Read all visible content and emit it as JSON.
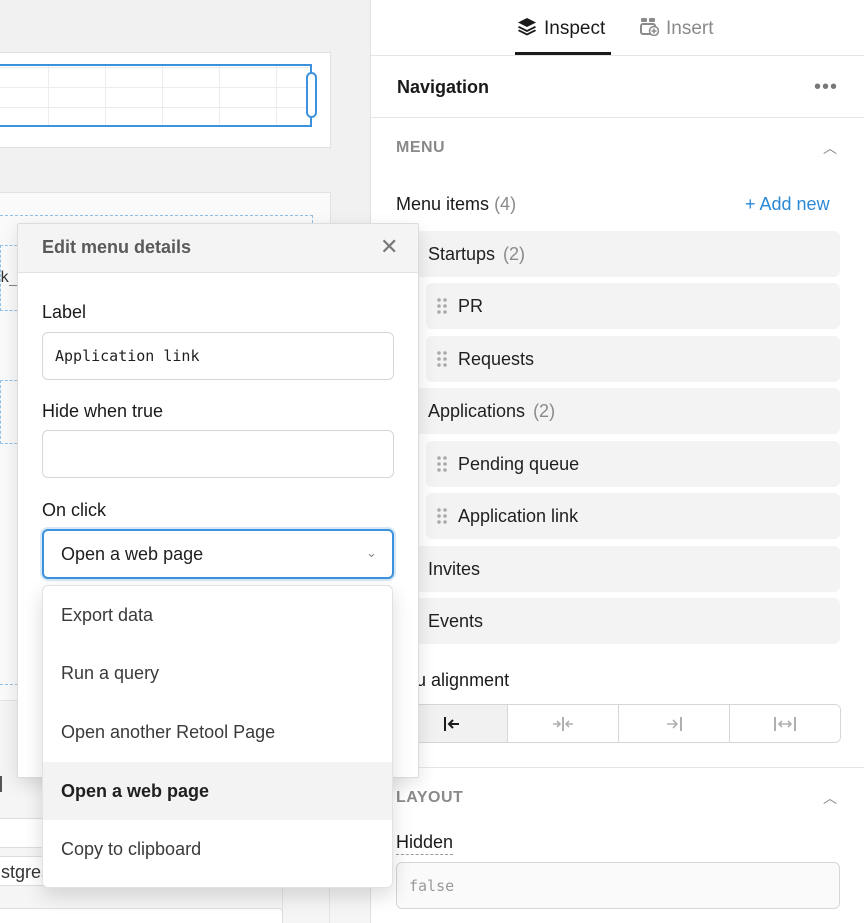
{
  "canvas": {
    "fragment_top": "k_",
    "fragment_bottom": "stgres"
  },
  "tabs": [
    {
      "label": "Inspect",
      "icon": "layers-icon",
      "active": true
    },
    {
      "label": "Insert",
      "icon": "insert-component-icon",
      "active": false
    }
  ],
  "inspector": {
    "title": "Navigation",
    "menu_section": "MENU",
    "menu_items_label": "Menu items",
    "menu_items_count": "(4)",
    "add_new": "+ Add new",
    "items": [
      {
        "label": "Startups",
        "count": "(2)",
        "level": 0
      },
      {
        "label": "PR",
        "level": 1
      },
      {
        "label": "Requests",
        "level": 1
      },
      {
        "label": "Applications",
        "count": "(2)",
        "level": 0
      },
      {
        "label": "Pending queue",
        "level": 1
      },
      {
        "label": "Application link",
        "level": 1
      },
      {
        "label": "Invites",
        "level": 0
      },
      {
        "label": "Events",
        "level": 0
      }
    ],
    "alignment_label": "enu alignment",
    "alignment_options": [
      "align-left",
      "align-center",
      "align-right",
      "justify"
    ],
    "alignment_selected": "align-left",
    "layout_section": "LAYOUT",
    "hidden_label": "Hidden",
    "hidden_value": "false"
  },
  "modal": {
    "title": "Edit menu details",
    "label_field": {
      "label": "Label",
      "value": "Application link"
    },
    "hide_field": {
      "label": "Hide when true",
      "value": ""
    },
    "onclick_field": {
      "label": "On click",
      "value": "Open a web page"
    },
    "options": [
      "Export data",
      "Run a query",
      "Open another Retool Page",
      "Open a web page",
      "Copy to clipboard"
    ],
    "selected_option": "Open a web page"
  },
  "colors": {
    "accent": "#3c92dc",
    "link": "#2a88d6",
    "muted": "#8a8a8a"
  }
}
